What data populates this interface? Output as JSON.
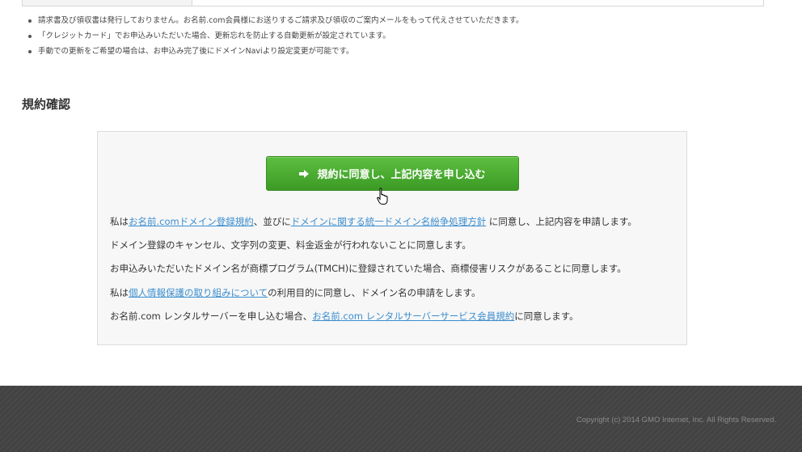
{
  "notes": [
    "請求書及び領収書は発行しておりません。お名前.com会員様にお送りするご請求及び領収のご案内メールをもって代えさせていただきます。",
    "「クレジットカード」でお申込みいただいた場合、更新忘れを防止する自動更新が設定されています。",
    "手動での更新をご希望の場合は、お申込み完了後にドメインNaviより設定変更が可能です。"
  ],
  "section_title": "規約確認",
  "apply_button_label": "規約に同意し、上記内容を申し込む",
  "terms": {
    "line1": {
      "prefix": "私は",
      "link1": "お名前.comドメイン登録規約",
      "mid": "、並びに",
      "link2": "ドメインに関する統一ドメイン名紛争処理方針",
      "suffix": " に同意し、上記内容を申請します。"
    },
    "line2": "ドメイン登録のキャンセル、文字列の変更、料金返金が行われないことに同意します。",
    "line3": "お申込みいただいたドメイン名が商標プログラム(TMCH)に登録されていた場合、商標侵害リスクがあることに同意します。",
    "line4": {
      "prefix": "私は",
      "link": "個人情報保護の取り組みについて",
      "suffix": "の利用目的に同意し、ドメイン名の申請をします。"
    },
    "line5": {
      "prefix": "お名前.com レンタルサーバーを申し込む場合、",
      "link": "お名前.com レンタルサーバーサービス会員規約",
      "suffix": "に同意します。"
    }
  },
  "footer": {
    "copyright": "Copyright (c) 2014 GMO Internet, Inc. All Rights Reserved."
  },
  "colors": {
    "button_green": "#4cae32",
    "link_blue": "#3b8ecf",
    "footer_bg": "#424242"
  }
}
